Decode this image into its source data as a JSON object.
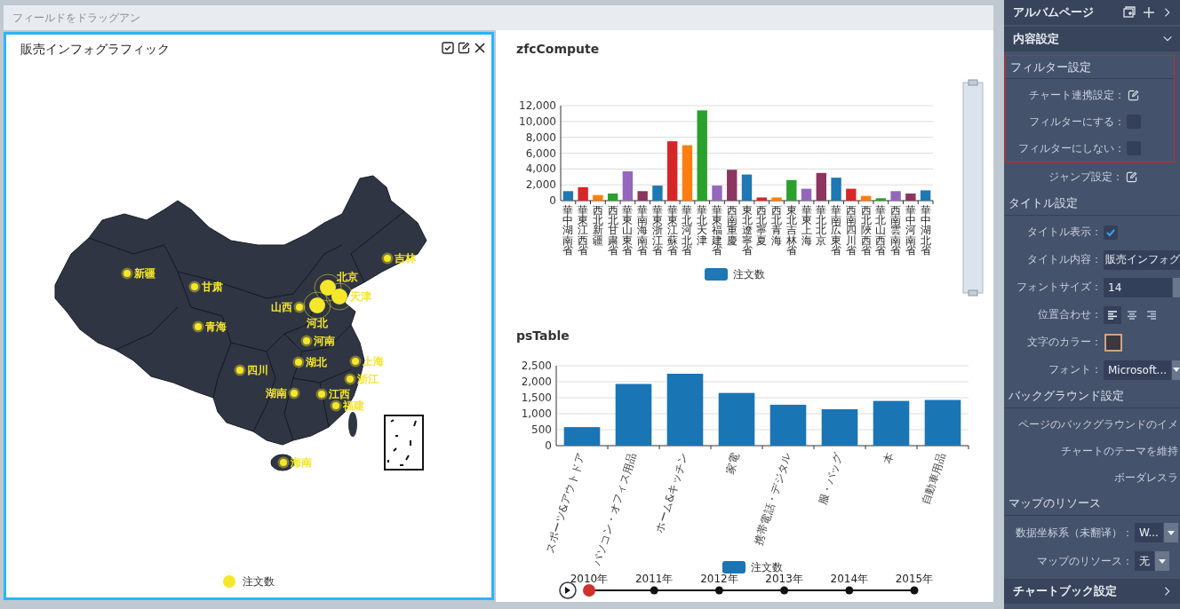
{
  "drop_zone": {
    "label": "フィールドをドラッグアン"
  },
  "map_card": {
    "title": "販売インフォグラフィック",
    "selected": true,
    "legend": "注文数",
    "markers": [
      {
        "label": "新疆",
        "kind": "small"
      },
      {
        "label": "甘肃",
        "kind": "small"
      },
      {
        "label": "青海",
        "kind": "small"
      },
      {
        "label": "四川",
        "kind": "small"
      },
      {
        "label": "吉林",
        "kind": "small"
      },
      {
        "label": "北京",
        "kind": "large"
      },
      {
        "label": "天津",
        "kind": "large"
      },
      {
        "label": "山西",
        "kind": "small"
      },
      {
        "label": "河北",
        "kind": "large"
      },
      {
        "label": "河南",
        "kind": "small"
      },
      {
        "label": "湖北",
        "kind": "small"
      },
      {
        "label": "上海",
        "kind": "small"
      },
      {
        "label": "浙江",
        "kind": "small"
      },
      {
        "label": "湖南",
        "kind": "small"
      },
      {
        "label": "江西",
        "kind": "small"
      },
      {
        "label": "福建",
        "kind": "small"
      },
      {
        "label": "海南",
        "kind": "small"
      }
    ]
  },
  "charts": [
    {
      "title": "zfcCompute",
      "chart_data": {
        "type": "bar",
        "grid": true,
        "categories": [
          "華中湖南省",
          "華東江西省",
          "西北新疆",
          "西北甘粛省",
          "華東山東省",
          "華南海南省",
          "華東浙江省",
          "華東江蘇省",
          "華北河北省",
          "華北天津",
          "華東福建省",
          "西南重慶",
          "東北遼寧省",
          "西北寧夏",
          "西北青海",
          "東北吉林省",
          "華東上海",
          "華北北京",
          "華南広東省",
          "西南四川省",
          "西北陜西省",
          "華北山西省",
          "西南雲南省",
          "華中河南省",
          "華中湖北省"
        ],
        "series": [
          {
            "name": "注文数",
            "color": "#1f77b4",
            "colors": [
              "#1f77b4",
              "#d62728",
              "#ff7f0e",
              "#2ca02c",
              "#9467bd",
              "#8c3561",
              "#1f77b4",
              "#d62728",
              "#ff7f0e",
              "#2ca02c",
              "#9467bd",
              "#8c3561",
              "#1f77b4",
              "#d62728",
              "#ff7f0e",
              "#2ca02c",
              "#9467bd",
              "#8c3561",
              "#1f77b4",
              "#d62728",
              "#ff7f0e",
              "#2ca02c",
              "#9467bd",
              "#8c3561",
              "#1f77b4"
            ],
            "values": [
              1200,
              1700,
              700,
              900,
              3700,
              1200,
              1900,
              7500,
              7000,
              11400,
              1900,
              3900,
              3300,
              400,
              400,
              2600,
              1500,
              3500,
              2900,
              1500,
              600,
              300,
              1200,
              900,
              1300
            ]
          }
        ],
        "ylim": [
          0,
          12000
        ],
        "yticks": [
          {
            "value": 0,
            "label": "0"
          },
          {
            "value": 2000,
            "label": "2,000"
          },
          {
            "value": 4000,
            "label": "4,000"
          },
          {
            "value": 6000,
            "label": "6,000"
          },
          {
            "value": 8000,
            "label": "8,000"
          },
          {
            "value": 10000,
            "label": "10,000"
          },
          {
            "value": 12000,
            "label": "12,000"
          }
        ]
      }
    },
    {
      "title": "psTable",
      "chart_data": {
        "type": "bar",
        "grid": true,
        "categories": [
          "スポーツ&アウトドア",
          "パソコン・オフィス用品",
          "ホーム&キッチン",
          "家電",
          "携帯電話・デジタル",
          "服・バッグ",
          "本",
          "自動車用品"
        ],
        "series": [
          {
            "name": "注文数",
            "color": "#1a75b5",
            "values": [
              580,
              1930,
              2250,
              1650,
              1280,
              1140,
              1400,
              1430
            ]
          }
        ],
        "ylim": [
          0,
          2500
        ],
        "yticks": [
          {
            "value": 0,
            "label": "0"
          },
          {
            "value": 500,
            "label": "500"
          },
          {
            "value": 1000,
            "label": "1,000"
          },
          {
            "value": 1500,
            "label": "1,500"
          },
          {
            "value": 2000,
            "label": "2,000"
          },
          {
            "value": 2500,
            "label": "2,500"
          }
        ]
      },
      "timeline": [
        {
          "label": "2010年",
          "selected": true
        },
        {
          "label": "2011年",
          "selected": false
        },
        {
          "label": "2012年",
          "selected": false
        },
        {
          "label": "2013年",
          "selected": false
        },
        {
          "label": "2014年",
          "selected": false
        },
        {
          "label": "2015年",
          "selected": false
        }
      ]
    }
  ],
  "panel": {
    "header": {
      "title": "アルバムページ"
    },
    "section": {
      "title": "内容設定",
      "expanded": true
    },
    "groups": [
      {
        "title": "フィルター設定",
        "highlighted": true,
        "rows": [
          {
            "kind": "edit",
            "label": "チャート連携設定："
          },
          {
            "kind": "checkbox",
            "label": "フィルターにする：",
            "checked": false
          },
          {
            "kind": "checkbox",
            "label": "フィルターにしない：",
            "checked": false
          }
        ]
      },
      {
        "rows": [
          {
            "kind": "edit",
            "label": "ジャンプ設定："
          }
        ]
      },
      {
        "title": "タイトル設定",
        "rows": [
          {
            "kind": "checkbox",
            "label": "タイトル表示：",
            "checked": true
          },
          {
            "kind": "text",
            "label": "タイトル内容：",
            "value": "販売インフォグ"
          },
          {
            "kind": "spinner",
            "label": "フォントサイズ：",
            "value": "14"
          },
          {
            "kind": "align",
            "label": "位置合わせ：",
            "options": [
              {
                "kind": "left",
                "selected": true
              },
              {
                "kind": "center",
                "selected": false
              },
              {
                "kind": "right",
                "selected": false
              }
            ]
          },
          {
            "kind": "color",
            "label": "文字のカラー：",
            "color": "#3a3a3e"
          },
          {
            "kind": "select",
            "label": "フォント：",
            "value": "Microsoft..."
          }
        ]
      },
      {
        "title": "バックグラウンド設定",
        "rows": [
          {
            "kind": "plain",
            "label": "ページのバックグラウンドのイメ"
          },
          {
            "kind": "plain",
            "label": "チャートのテーマを維持"
          },
          {
            "kind": "plain",
            "label": "ボーダレスラ"
          }
        ]
      },
      {
        "title": "マップのリソース",
        "rows": [
          {
            "kind": "select",
            "label": "数据坐标系（未翻译）：",
            "value": "W..."
          },
          {
            "kind": "select",
            "label": "マップのリソース：",
            "value": "无"
          }
        ]
      }
    ],
    "footer": {
      "title": "チャートブック設定"
    }
  }
}
